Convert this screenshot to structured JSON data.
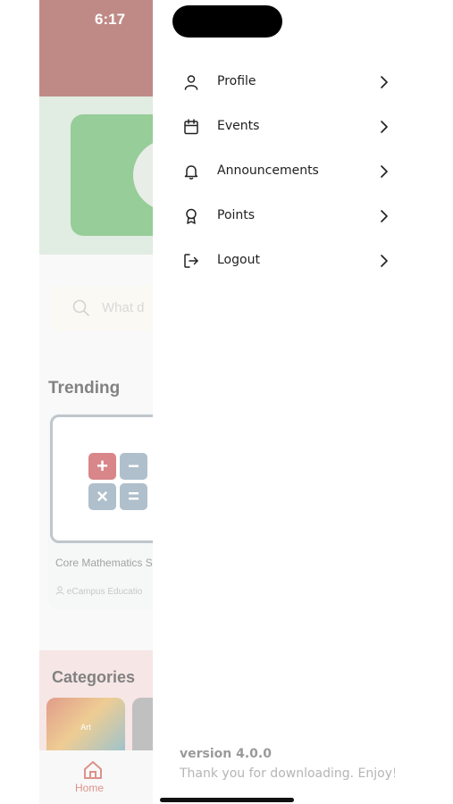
{
  "status_bar": {
    "time": "6:17"
  },
  "background_screen": {
    "search_placeholder": "What d",
    "trending_title": "Trending",
    "card": {
      "title": "Core Mathematics SHS",
      "author": "eCampus Educatio"
    },
    "categories_title": "Categories",
    "category_tile_label": "Art",
    "tabbar": {
      "home_label": "Home"
    }
  },
  "drawer": {
    "items": [
      {
        "label": "Profile",
        "icon": "person-icon"
      },
      {
        "label": "Events",
        "icon": "calendar-icon"
      },
      {
        "label": "Announcements",
        "icon": "bell-icon"
      },
      {
        "label": "Points",
        "icon": "award-icon"
      },
      {
        "label": "Logout",
        "icon": "logout-icon"
      }
    ],
    "version": "version 4.0.0",
    "thanks": "Thank you for downloading. Enjoy!"
  },
  "colors": {
    "brand_red": "#8b2a23",
    "accent_green": "#43a544",
    "tab_active": "#c0392b"
  }
}
